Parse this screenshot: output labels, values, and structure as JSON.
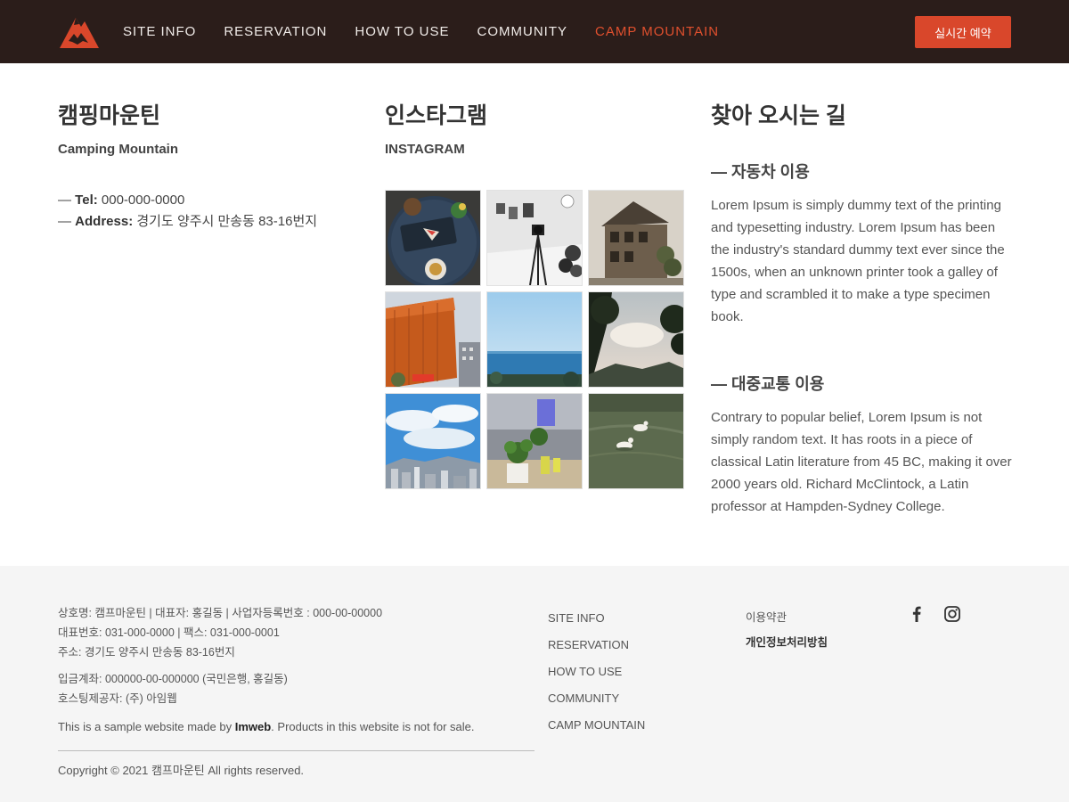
{
  "header": {
    "nav": [
      "SITE INFO",
      "RESERVATION",
      "HOW TO USE",
      "COMMUNITY",
      "CAMP MOUNTAIN"
    ],
    "active_index": 4,
    "reserve_label": "실시간 예약",
    "accent": "#e0502e",
    "background": "#2b1d1a"
  },
  "about": {
    "title": "캠핑마운틴",
    "subtitle": "Camping Mountain",
    "tel_label": "Tel:",
    "tel_value": "000-000-0000",
    "address_label": "Address:",
    "address_value": "경기도 양주시 만송동 83-16번지"
  },
  "instagram": {
    "title": "인스타그램",
    "subtitle": "INSTAGRAM",
    "photos": [
      "cafe-table-photo",
      "studio-camera-photo",
      "old-building-photo",
      "orange-building-photo",
      "sea-horizon-photo",
      "sunset-trees-photo",
      "city-skyline-photo",
      "desk-plants-photo",
      "ducks-pond-photo"
    ]
  },
  "directions": {
    "title": "찾아 오시는 길",
    "car_heading": "— 자동차 이용",
    "car_text": "Lorem Ipsum is simply dummy text of the printing and typesetting industry. Lorem Ipsum has been the industry's standard dummy text ever since the 1500s, when an unknown printer took a galley of type and scrambled it to make a type specimen book.",
    "transit_heading": "— 대중교통 이용",
    "transit_text": "Contrary to popular belief, Lorem Ipsum is not simply random text. It has roots in a piece of classical Latin literature from 45 BC, making it over 2000 years old. Richard McClintock, a Latin professor at Hampden-Sydney College."
  },
  "footer": {
    "line1": "상호명: 캠프마운틴 | 대표자: 홍길동 | 사업자등록번호 : 000-00-00000",
    "line2": "대표번호: 031-000-0000 | 팩스: 031-000-0001",
    "line3": "주소: 경기도 양주시 만송동 83-16번지",
    "line4": "입금계좌: 000000-00-000000 (국민은행, 홍길동)",
    "line5": "호스팅제공자: (주) 아임웹",
    "sample_prefix": "This is a sample website made by ",
    "sample_brand": "Imweb",
    "sample_suffix": ". Products in this website is not for sale.",
    "copyright": "Copyright © 2021 캠프마운틴 All rights reserved.",
    "nav": [
      "SITE INFO",
      "RESERVATION",
      "HOW TO USE",
      "COMMUNITY",
      "CAMP MOUNTAIN"
    ],
    "terms": "이용약관",
    "privacy": "개인정보처리방침",
    "social_icons": [
      "facebook-icon",
      "instagram-icon"
    ]
  }
}
